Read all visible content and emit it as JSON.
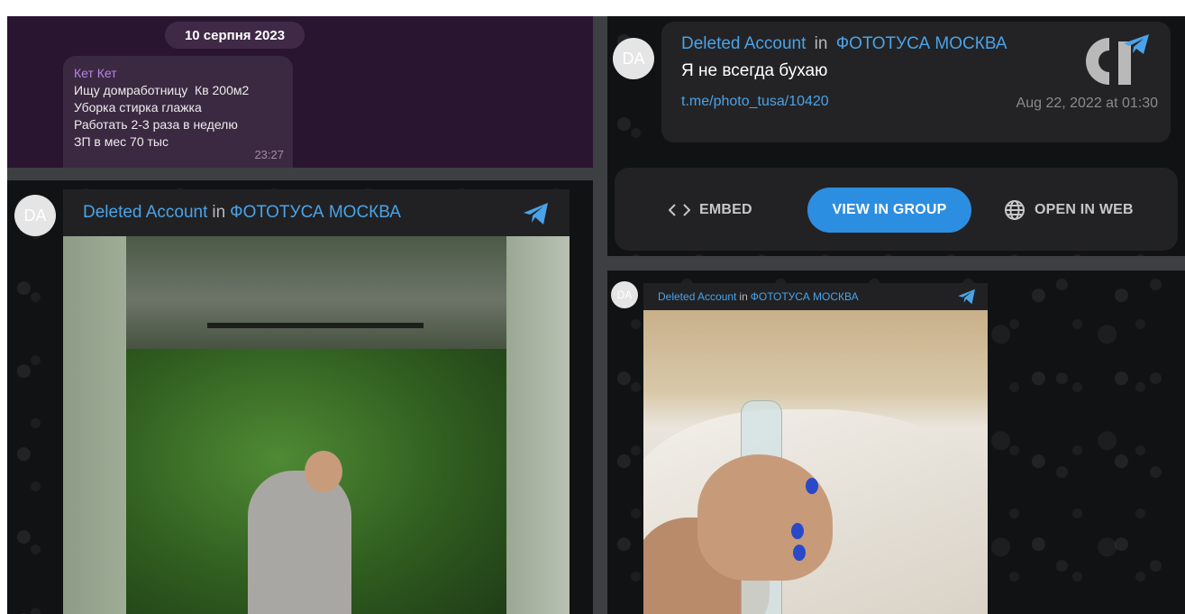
{
  "chat": {
    "date": "10 серпня 2023",
    "sender": "Кет Кет",
    "lines": [
      "Ищу домработницу  Кв 200м2",
      "Уборка стирка глажка",
      "Работать 2-3 раза в неделю",
      "ЗП в мес 70 тыс"
    ],
    "time": "23:27",
    "colors": {
      "background": "#2a1530",
      "bubble": "#3b2941",
      "sender": "#b784e6"
    }
  },
  "post_left": {
    "avatar": "DA",
    "author": "Deleted Account",
    "in_word": "in",
    "channel": "ФОТОТУСА МОСКВА",
    "icon": "telegram-plane-icon"
  },
  "embed": {
    "avatar": "DA",
    "author": "Deleted Account",
    "in_word": "in",
    "channel": "ФОТОТУСА МОСКВА",
    "text": "Я не всегда бухаю",
    "link": "t.me/photo_tusa/10420",
    "date": "Aug 22, 2022 at 01:30",
    "logo_icon": "c1-logo-icon",
    "actions": {
      "embed_label": "EMBED",
      "embed_icon": "code-icon",
      "view_label": "VIEW IN GROUP",
      "web_label": "OPEN IN WEB",
      "web_icon": "globe-icon"
    },
    "colors": {
      "accent": "#2c8ee1",
      "link": "#4aa3e8"
    }
  },
  "post_right": {
    "avatar": "DA",
    "author": "Deleted Account",
    "in_word": "in",
    "channel": "ФОТОТУСА МОСКВА",
    "icon": "telegram-plane-icon"
  }
}
